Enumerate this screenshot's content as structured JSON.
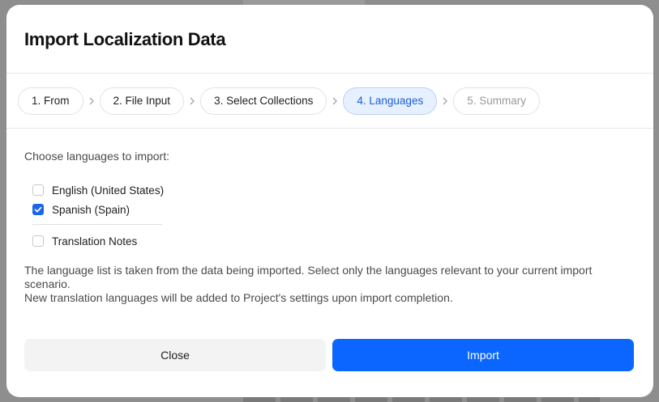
{
  "dialog": {
    "title": "Import Localization Data"
  },
  "stepper": {
    "steps": [
      {
        "label": "1. From",
        "state": "done"
      },
      {
        "label": "2. File Input",
        "state": "done"
      },
      {
        "label": "3. Select Collections",
        "state": "done"
      },
      {
        "label": "4. Languages",
        "state": "active"
      },
      {
        "label": "5. Summary",
        "state": "disabled"
      }
    ]
  },
  "languages": {
    "prompt": "Choose languages to import:",
    "items": [
      {
        "label": "English (United States)",
        "checked": false
      },
      {
        "label": "Spanish (Spain)",
        "checked": true
      }
    ],
    "extra": {
      "label": "Translation Notes",
      "checked": false
    }
  },
  "info": {
    "line1": "The language list is taken from the data being imported. Select only the languages relevant to your current import scenario.",
    "line2": "New translation languages will be added to Project's settings upon import completion."
  },
  "footer": {
    "close_label": "Close",
    "import_label": "Import"
  },
  "colors": {
    "accent": "#0a66ff",
    "active_step_bg": "#e7f0ff",
    "active_step_text": "#1a5fd6"
  }
}
